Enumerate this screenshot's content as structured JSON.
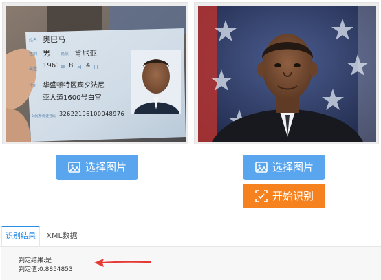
{
  "id_card": {
    "name_label": "姓名",
    "name_value": "奥巴马",
    "sex_label": "性别",
    "sex_value": "男",
    "nation_label": "民族",
    "nation_value": "肯尼亚",
    "birth_label": "出生",
    "birth_year": "1961",
    "birth_year_unit": "年",
    "birth_month": "8",
    "birth_month_unit": "月",
    "birth_day": "4",
    "birth_day_unit": "日",
    "address_label": "住址",
    "address_line1": "华盛顿特区宾夕法尼",
    "address_line2": "亚大道1600号白宫",
    "id_label": "公民身份证号码",
    "id_value": "32622196100048976"
  },
  "buttons": {
    "select_left": "选择图片",
    "select_right": "选择图片",
    "start": "开始识别"
  },
  "tabs": {
    "result": "识别结果",
    "xml": "XML数据"
  },
  "result": {
    "line1": "判定结果:是",
    "line2": "判定值:0.8854853"
  },
  "colors": {
    "primary_blue": "#5aa6ee",
    "orange": "#f5811f",
    "active_tab": "#2a8ee8",
    "arrow_red": "#e53935"
  }
}
